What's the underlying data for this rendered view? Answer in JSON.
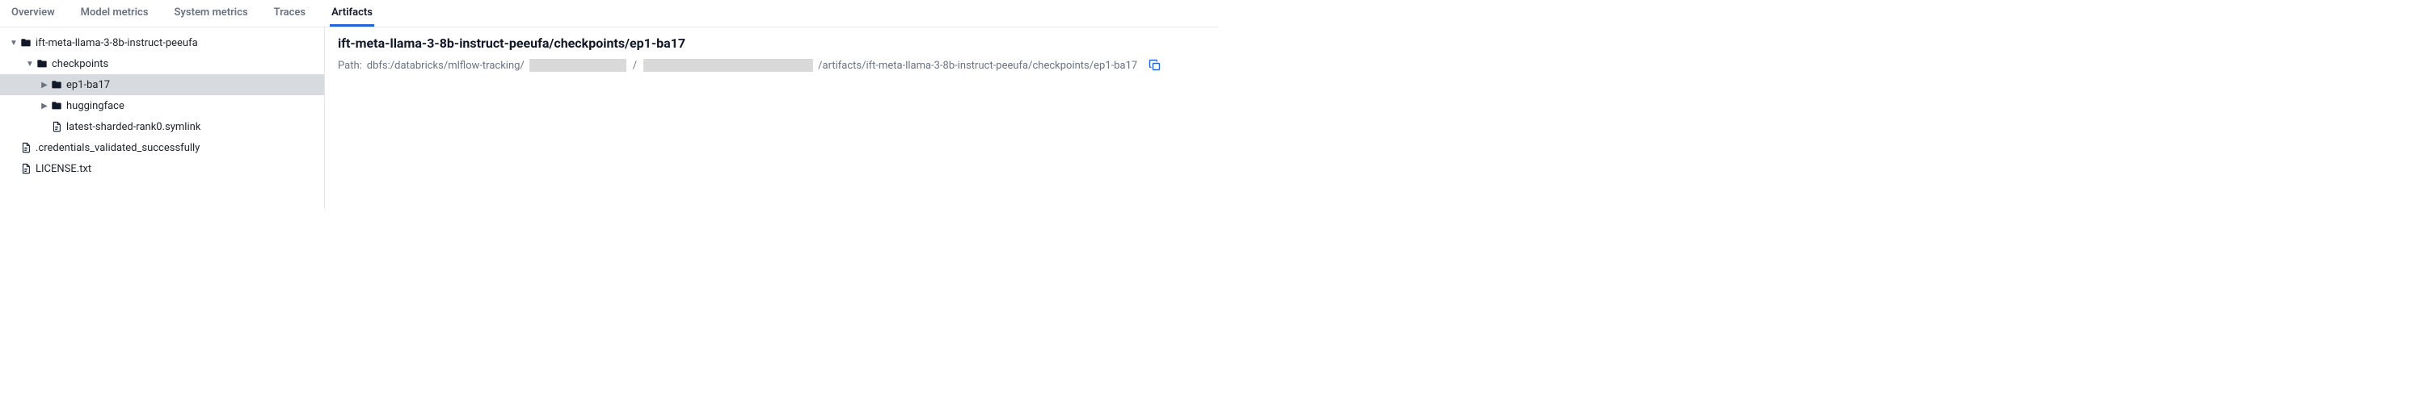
{
  "tabs": {
    "items": [
      {
        "label": "Overview",
        "active": false
      },
      {
        "label": "Model metrics",
        "active": false
      },
      {
        "label": "System metrics",
        "active": false
      },
      {
        "label": "Traces",
        "active": false
      },
      {
        "label": "Artifacts",
        "active": true
      }
    ]
  },
  "tree": {
    "items": [
      {
        "depth": 0,
        "kind": "folder",
        "state": "open",
        "label": "ift-meta-llama-3-8b-instruct-peeufa",
        "selected": false
      },
      {
        "depth": 1,
        "kind": "folder",
        "state": "open",
        "label": "checkpoints",
        "selected": false
      },
      {
        "depth": 2,
        "kind": "folder",
        "state": "closed",
        "label": "ep1-ba17",
        "selected": true
      },
      {
        "depth": 2,
        "kind": "folder",
        "state": "closed",
        "label": "huggingface",
        "selected": false
      },
      {
        "depth": 2,
        "kind": "file",
        "state": "none",
        "label": "latest-sharded-rank0.symlink",
        "selected": false
      },
      {
        "depth": 0,
        "kind": "file",
        "state": "none",
        "label": ".credentials_validated_successfully",
        "selected": false
      },
      {
        "depth": 0,
        "kind": "file",
        "state": "none",
        "label": "LICENSE.txt",
        "selected": false
      }
    ]
  },
  "detail": {
    "title": "ift-meta-llama-3-8b-instruct-peeufa/checkpoints/ep1-ba17",
    "path_label": "Path:",
    "path_prefix": "dbfs:/databricks/mlflow-tracking/",
    "path_sep": "/",
    "path_suffix": "/artifacts/ift-meta-llama-3-8b-instruct-peeufa/checkpoints/ep1-ba17"
  }
}
